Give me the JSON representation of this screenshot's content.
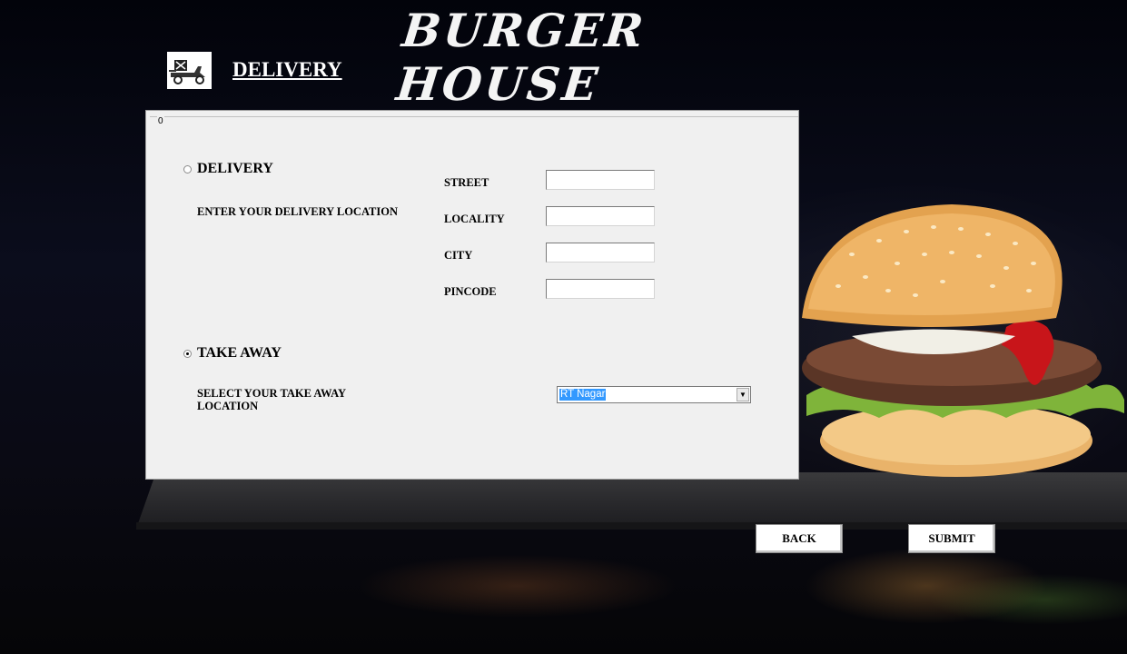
{
  "app": {
    "title": "BURGER HOUSE"
  },
  "header": {
    "page_heading": "DELIVERY",
    "logo_icon": "delivery-scooter-icon"
  },
  "panel": {
    "group_caption": "0",
    "delivery": {
      "radio_label": "DELIVERY",
      "selected": false,
      "hint": "ENTER YOUR DELIVERY LOCATION",
      "fields": [
        {
          "label": "STREET",
          "value": ""
        },
        {
          "label": "LOCALITY",
          "value": ""
        },
        {
          "label": "CITY",
          "value": ""
        },
        {
          "label": "PINCODE",
          "value": ""
        }
      ]
    },
    "takeaway": {
      "radio_label": "TAKE AWAY",
      "selected": true,
      "hint": "SELECT YOUR TAKE AWAY LOCATION",
      "selected_location": "RT Nagar"
    }
  },
  "buttons": {
    "back": "BACK",
    "submit": "SUBMIT"
  },
  "colors": {
    "panel_bg": "#f0f0f0",
    "selection": "#3399ff",
    "page_bg": "#05070f"
  }
}
